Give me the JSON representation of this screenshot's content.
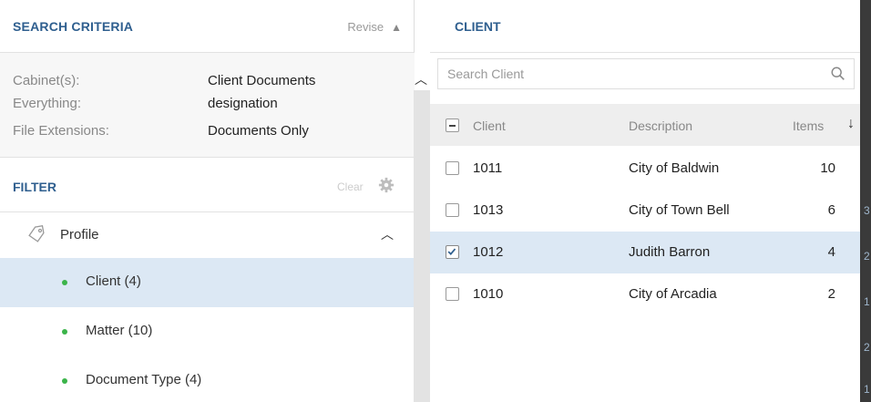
{
  "search_criteria": {
    "title": "SEARCH CRITERIA",
    "revise_label": "Revise",
    "collapse_icon": "▲",
    "rows": [
      {
        "key": "Cabinet(s):",
        "value": "Client Documents"
      },
      {
        "key": "Everything:",
        "value": "designation"
      },
      {
        "key": "File Extensions:",
        "value": "Documents Only"
      }
    ]
  },
  "filter": {
    "title": "FILTER",
    "clear_label": "Clear",
    "profile_label": "Profile",
    "items": [
      {
        "label": "Client (4)",
        "selected": true
      },
      {
        "label": "Matter (10)",
        "selected": false
      },
      {
        "label": "Document Type (4)",
        "selected": false
      }
    ]
  },
  "client_panel": {
    "title": "CLIENT",
    "search_placeholder": "Search Client",
    "columns": {
      "client": "Client",
      "description": "Description",
      "items": "Items"
    },
    "rows": [
      {
        "client": "1011",
        "description": "City of Baldwin",
        "items": "10",
        "checked": false
      },
      {
        "client": "1013",
        "description": "City of Town Bell",
        "items": "6",
        "checked": false
      },
      {
        "client": "1012",
        "description": "Judith Barron",
        "items": "4",
        "checked": true
      },
      {
        "client": "1010",
        "description": "City of Arcadia",
        "items": "2",
        "checked": false
      }
    ]
  },
  "edge_numbers": [
    "3",
    "2",
    "1",
    "2",
    "1"
  ],
  "colors": {
    "heading": "#2f5f8f",
    "selected_row": "#dce8f4",
    "dot": "#3bb44a"
  }
}
